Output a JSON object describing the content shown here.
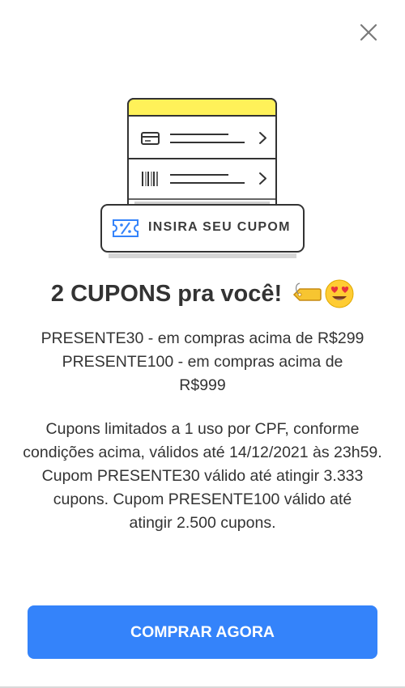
{
  "modal": {
    "close_icon": "close-icon",
    "illustration": {
      "card_icon": "credit-card-icon",
      "barcode_icon": "barcode-icon",
      "chevron_icon": "chevron-right-icon",
      "coupon_icon": "coupon-percent-icon",
      "coupon_label": "INSIRA SEU CUPOM",
      "accent_color": "#fff159"
    },
    "title": "2 CUPONS pra você!",
    "title_emojis": [
      "label-tag-emoji",
      "heart-eyes-emoji"
    ],
    "codes": [
      "PRESENTE30 - em compras acima de R$299",
      "PRESENTE100 - em compras acima de R$999"
    ],
    "rules": "Cupons limitados a 1 uso por CPF, conforme condições acima, válidos até 14/12/2021 às 23h59.",
    "limits": "Cupom PRESENTE30 válido até atingir 3.333 cupons. Cupom PRESENTE100 válido até atingir 2.500 cupons.",
    "cta_label": "COMPRAR AGORA",
    "cta_color": "#3483fa"
  }
}
